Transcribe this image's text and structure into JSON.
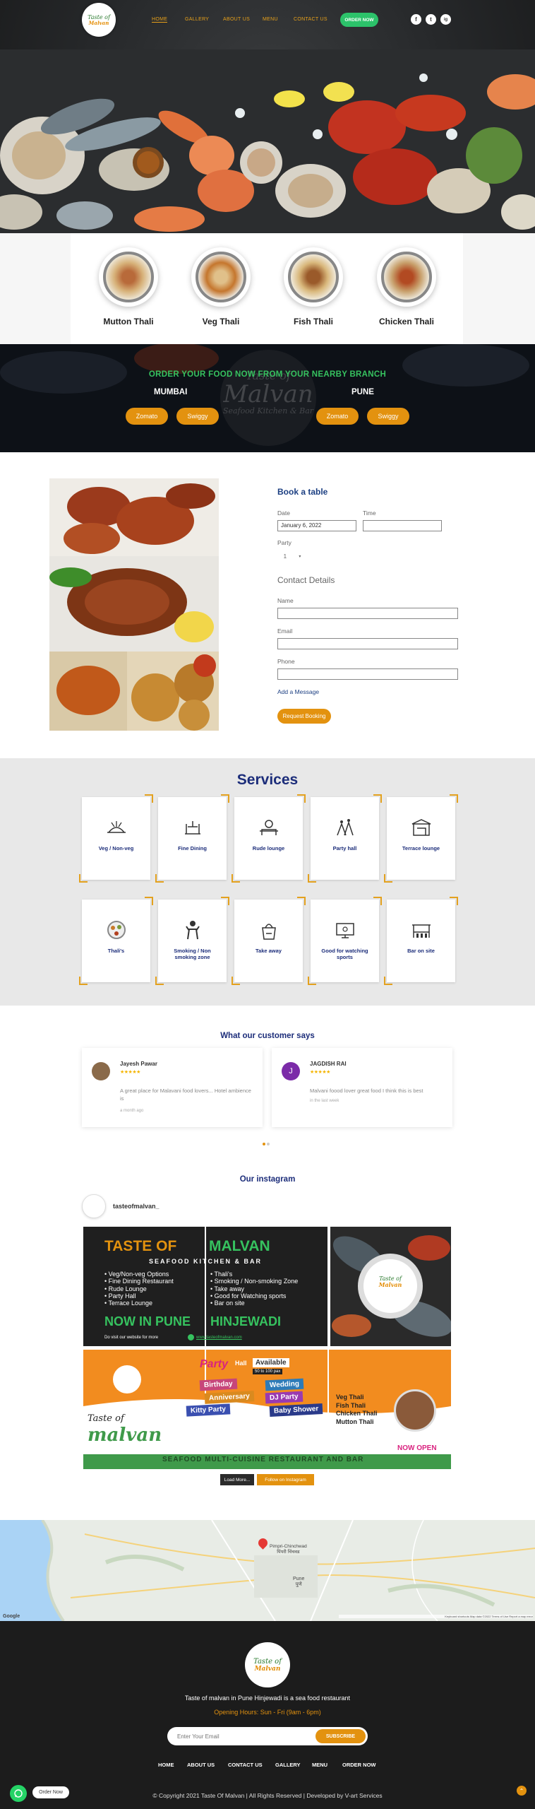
{
  "nav": {
    "logo_text": "Taste of",
    "logo_text2": "Malvan",
    "links": [
      "HOME",
      "GALLERY",
      "ABOUT US",
      "MENU",
      "CONTACT US"
    ],
    "order_now": "ORDER NOW",
    "social": [
      "f",
      "t",
      "ig"
    ]
  },
  "thalis": [
    "Mutton Thali",
    "Veg Thali",
    "Fish Thali",
    "Chicken Thali"
  ],
  "order_branch": {
    "title": "ORDER YOUR FOOD NOW FROM YOUR NEARBY BRANCH",
    "cities": [
      "MUMBAI",
      "PUNE"
    ],
    "mumbai_zomato": "Zomato",
    "mumbai_swiggy": "Swiggy",
    "pune_zomato": "Zomato",
    "pune_swiggy": "Swiggy",
    "watermark_line1": "Taste of",
    "watermark_line2": "Malvan",
    "watermark_line3": "Seafood Kitchen & Bar"
  },
  "booking": {
    "title": "Book a table",
    "date_label": "Date",
    "date_value": "January 6, 2022",
    "time_label": "Time",
    "party_label": "Party",
    "party_value": "1",
    "contact_title": "Contact Details",
    "name_label": "Name",
    "email_label": "Email",
    "phone_label": "Phone",
    "message_link": "Add a Message",
    "submit": "Request Booking"
  },
  "services": {
    "title": "Services",
    "items": [
      {
        "label": "Veg / Non-veg",
        "icon": "dish-icon"
      },
      {
        "label": "Fine Dining",
        "icon": "dining-icon"
      },
      {
        "label": "Rude lounge",
        "icon": "lounge-icon"
      },
      {
        "label": "Party hall",
        "icon": "party-icon"
      },
      {
        "label": "Terrace lounge",
        "icon": "terrace-icon"
      },
      {
        "label": "Thali's",
        "icon": "thali-icon"
      },
      {
        "label": "Smoking / Non smoking zone",
        "icon": "smoking-icon"
      },
      {
        "label": "Take away",
        "icon": "takeaway-icon"
      },
      {
        "label": "Good for watching sports",
        "icon": "tv-icon"
      },
      {
        "label": "Bar on site",
        "icon": "bar-icon"
      }
    ]
  },
  "reviews": {
    "title": "What our customer says",
    "items": [
      {
        "name": "Jayesh Pawar",
        "stars": "★★★★★",
        "text": "A great place for Malavani food lovers... Hotel ambience is",
        "time": "a month ago",
        "initial": ""
      },
      {
        "name": "JAGDISH RAI",
        "stars": "★★★★★",
        "text": "Malvani foood lover great food I think this is best",
        "time": "in the last week",
        "initial": "J"
      }
    ]
  },
  "instagram": {
    "title": "Our instagram",
    "handle": "tasteofmalvan_",
    "post1": {
      "title_a": "TASTE OF",
      "title_b": "MALVAN",
      "subtitle": "SEAFOOD KITCHEN & BAR",
      "list_left": [
        "Veg/Non-veg Options",
        "Fine Dining Restaurant",
        "Rude Lounge",
        "Party Hall",
        "Terrace Lounge"
      ],
      "list_right": [
        "Thali's",
        "Smoking / Non-smoking Zone",
        "Take away",
        "Good for Watching sports",
        "Bar on site"
      ],
      "now_in": "NOW IN PUNE",
      "hinjewadi": "HINJEWADI",
      "visit": "Do visit our website for more",
      "url": "www.tasteofmalvan.com"
    },
    "post2": {
      "party": "Party",
      "hall": "Hall",
      "available": "Available",
      "capacity": "50 to 100 pax",
      "tags": [
        "Birthday",
        "Wedding",
        "Anniversary",
        "DJ Party",
        "Kitty Party",
        "Baby Shower"
      ],
      "brand1": "Taste of",
      "brand2": "malvan",
      "thalis": [
        "Veg Thali",
        "Fish Thali",
        "Chicken Thali",
        "Mutton Thali"
      ],
      "now_open": "NOW OPEN",
      "banner": "SEAFOOD  MULTI-CUISINE RESTAURANT AND BAR"
    },
    "load_more": "Load More...",
    "follow": "Follow on Instagram"
  },
  "map": {
    "city1": "Pimpri-Chinchwad",
    "city1_local": "पिंपरी चिंचवड",
    "city2": "Pune",
    "city2_local": "पुणे",
    "google": "Google",
    "attrib": "Keyboard shortcuts   Map data ©2022   Terms of Use   Report a map error"
  },
  "footer": {
    "logo1": "Taste of",
    "logo2": "Malvan",
    "tagline": "Taste of malvan in Pune Hinjewadi is a sea food restaurant",
    "hours": "Opening Hours: Sun - Fri (9am - 6pm)",
    "email_placeholder": "Enter Your Email",
    "subscribe": "SUBSCRIBE",
    "links": [
      "HOME",
      "ABOUT US",
      "CONTACT US",
      "GALLERY",
      "MENU",
      "ORDER NOW"
    ],
    "copyright": "© Copyright 2021 Taste Of Malvan | All Rights Reserved | Developed by V-art Services",
    "whatsapp_label": "Order Now"
  },
  "colors": {
    "accent": "#e3920f",
    "navy": "#1c2d7a",
    "green": "#36c25f"
  }
}
